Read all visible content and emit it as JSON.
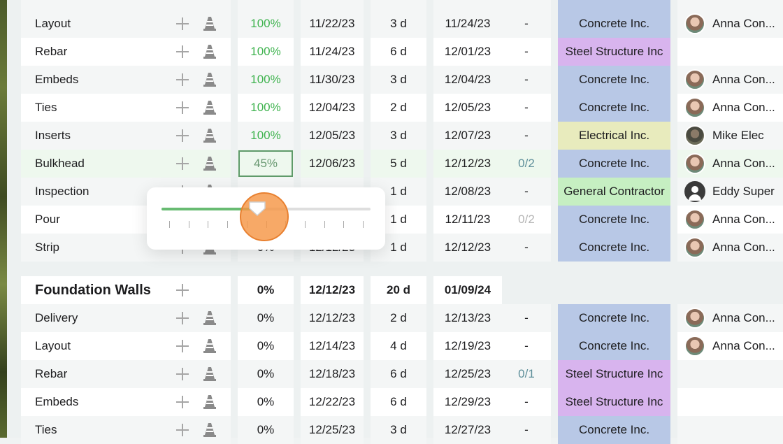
{
  "rows": [
    {
      "name": "Layout",
      "pct": "100%",
      "start": "11/22/23",
      "dur": "3 d",
      "end": "11/24/23",
      "dep": "-",
      "company": "Concrete Inc.",
      "company_color": "blue",
      "resource": "Anna Con...",
      "avatar": "anna"
    },
    {
      "name": "Rebar",
      "pct": "100%",
      "start": "11/24/23",
      "dur": "6 d",
      "end": "12/01/23",
      "dep": "-",
      "company": "Steel Structure Inc",
      "company_color": "purple",
      "resource": "",
      "avatar": ""
    },
    {
      "name": "Embeds",
      "pct": "100%",
      "start": "11/30/23",
      "dur": "3 d",
      "end": "12/04/23",
      "dep": "-",
      "company": "Concrete Inc.",
      "company_color": "blue",
      "resource": "Anna Con...",
      "avatar": "anna"
    },
    {
      "name": "Ties",
      "pct": "100%",
      "start": "12/04/23",
      "dur": "2 d",
      "end": "12/05/23",
      "dep": "-",
      "company": "Concrete Inc.",
      "company_color": "blue",
      "resource": "Anna Con...",
      "avatar": "anna"
    },
    {
      "name": "Inserts",
      "pct": "100%",
      "start": "12/05/23",
      "dur": "3 d",
      "end": "12/07/23",
      "dep": "-",
      "company": "Electrical Inc.",
      "company_color": "yellow",
      "resource": "Mike Elec",
      "avatar": "mike"
    },
    {
      "name": "Bulkhead",
      "pct": "45%",
      "start": "12/06/23",
      "dur": "5 d",
      "end": "12/12/23",
      "dep": "0/2",
      "company": "Concrete Inc.",
      "company_color": "blue",
      "resource": "Anna Con...",
      "avatar": "anna"
    },
    {
      "name": "Inspection",
      "pct": "",
      "start": "",
      "dur": "1 d",
      "end": "12/08/23",
      "dep": "-",
      "company": "General Contractor",
      "company_color": "green",
      "resource": "Eddy Super",
      "avatar": "eddy"
    },
    {
      "name": "Pour",
      "pct": "",
      "start": "",
      "dur": "1 d",
      "end": "12/11/23",
      "dep": "0/2",
      "company": "Concrete Inc.",
      "company_color": "blue",
      "resource": "Anna Con...",
      "avatar": "anna"
    },
    {
      "name": "Strip",
      "pct": "0%",
      "start": "12/12/23",
      "dur": "1 d",
      "end": "12/12/23",
      "dep": "-",
      "company": "Concrete Inc.",
      "company_color": "blue",
      "resource": "Anna Con...",
      "avatar": "anna"
    }
  ],
  "group": {
    "name": "Foundation Walls",
    "pct": "0%",
    "start": "12/12/23",
    "dur": "20 d",
    "end": "01/09/24"
  },
  "rows2": [
    {
      "name": "Delivery",
      "pct": "0%",
      "start": "12/12/23",
      "dur": "2 d",
      "end": "12/13/23",
      "dep": "-",
      "company": "Concrete Inc.",
      "company_color": "blue",
      "resource": "Anna Con...",
      "avatar": "anna"
    },
    {
      "name": "Layout",
      "pct": "0%",
      "start": "12/14/23",
      "dur": "4 d",
      "end": "12/19/23",
      "dep": "-",
      "company": "Concrete Inc.",
      "company_color": "blue",
      "resource": "Anna Con...",
      "avatar": "anna"
    },
    {
      "name": "Rebar",
      "pct": "0%",
      "start": "12/18/23",
      "dur": "6 d",
      "end": "12/25/23",
      "dep": "0/1",
      "company": "Steel Structure Inc",
      "company_color": "purple",
      "resource": "",
      "avatar": ""
    },
    {
      "name": "Embeds",
      "pct": "0%",
      "start": "12/22/23",
      "dur": "6 d",
      "end": "12/29/23",
      "dep": "-",
      "company": "Steel Structure Inc",
      "company_color": "purple",
      "resource": "",
      "avatar": ""
    },
    {
      "name": "Ties",
      "pct": "0%",
      "start": "12/25/23",
      "dur": "3 d",
      "end": "12/27/23",
      "dep": "-",
      "company": "Concrete Inc.",
      "company_color": "blue",
      "resource": "",
      "avatar": ""
    }
  ],
  "slider": {
    "progress_percent": 45,
    "tick_count": 11
  },
  "colors": {
    "progress_green": "#3fb34f",
    "knob": "#f59646",
    "company_blue": "#b8c8e6",
    "company_purple": "#d8b4ee",
    "company_yellow": "#e8ebbd",
    "company_green": "#c6efc2"
  },
  "icons": {
    "add": "plus-icon",
    "status": "traffic-cone-icon",
    "avatar_default": "user-avatar-icon"
  }
}
